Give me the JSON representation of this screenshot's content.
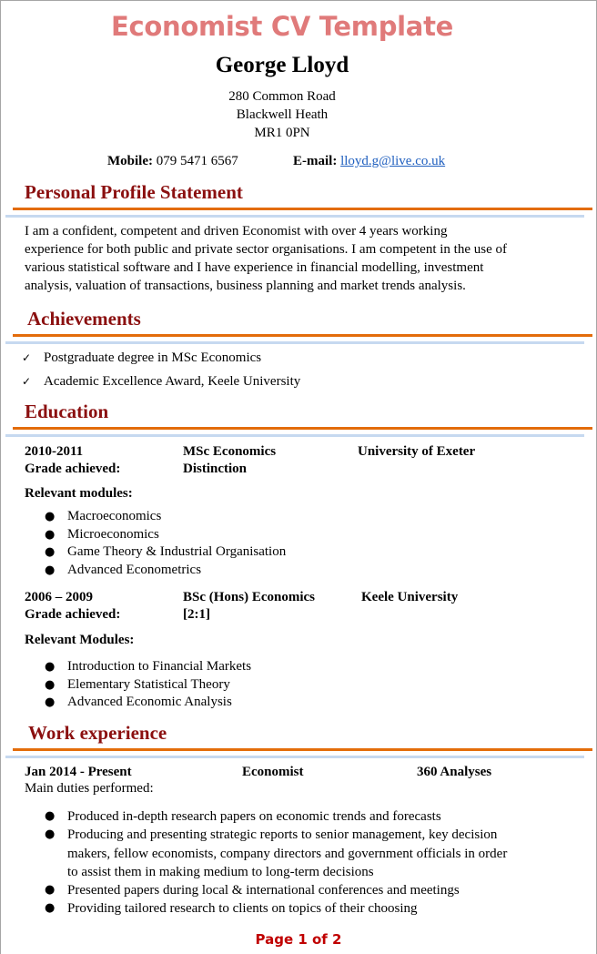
{
  "document": {
    "title": "Economist CV Template",
    "name": "George Lloyd",
    "address": [
      "280 Common Road",
      "Blackwell Heath",
      "MR1 0PN"
    ],
    "contact": {
      "mobile_label": "Mobile:",
      "mobile_value": "079 5471 6567",
      "email_label": "E-mail:",
      "email_value": "lloyd.g@live.co.uk"
    }
  },
  "sections": {
    "profile": {
      "title": "Personal Profile Statement",
      "lines": [
        "I am a confident, competent and driven Economist with over 4 years working",
        "experience for both public and private sector organisations.  I am competent in the use of",
        "various statistical software and I have experience in financial modelling, investment",
        "analysis, valuation of transactions, business planning and market trends analysis."
      ]
    },
    "achievements": {
      "title": "Achievements",
      "check_icon": "✓",
      "items": [
        "Postgraduate degree in MSc Economics",
        "Academic Excellence Award, Keele University"
      ]
    },
    "education": {
      "title": "Education",
      "entries": [
        {
          "dates": "2010-2011",
          "degree": "MSc Economics",
          "institution": "University of Exeter",
          "grade_label": "Grade achieved:",
          "grade": "Distinction",
          "modules_label": "Relevant modules:",
          "modules": [
            "Macroeconomics",
            "Microeconomics",
            "Game Theory & Industrial Organisation",
            "Advanced Econometrics"
          ]
        },
        {
          "dates": "2006 – 2009",
          "degree": "BSc (Hons) Economics",
          "institution": "Keele University",
          "grade_label": "Grade achieved:",
          "grade": "[2:1]",
          "modules_label": "Relevant Modules:",
          "modules": [
            "Introduction to Financial Markets",
            "Elementary Statistical Theory",
            "Advanced Economic Analysis"
          ]
        }
      ]
    },
    "work": {
      "title": "Work experience",
      "entries": [
        {
          "dates": "Jan 2014 - Present",
          "role": "Economist",
          "company": "360 Analyses",
          "duties_label": "Main duties performed:",
          "duties": [
            [
              "Produced in-depth research papers on economic trends and forecasts"
            ],
            [
              "Producing and presenting strategic reports to senior management, key decision",
              "makers, fellow economists, company directors and government officials in order",
              "to assist them in making medium to long-term decisions"
            ],
            [
              "Presented papers during local & international conferences and meetings"
            ],
            [
              "Providing tailored research to clients on topics of their choosing"
            ]
          ]
        }
      ]
    }
  },
  "bullet_icon": "●",
  "footer": {
    "page_label": "Page 1 of 2"
  },
  "colors": {
    "title": "#e07a7a",
    "section_title": "#8b1010",
    "rule_orange": "#e36c0a",
    "rule_blue": "#c6d9f0",
    "link": "#1f5fbf",
    "footer": "#c00000"
  }
}
